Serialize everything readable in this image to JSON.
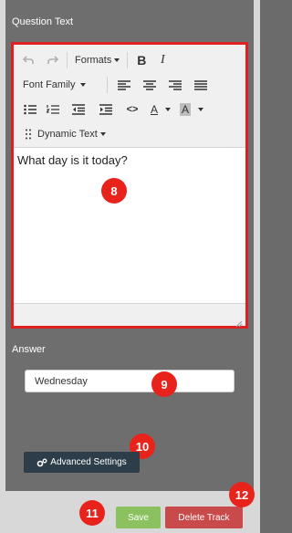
{
  "question_section": {
    "label": "Question Text"
  },
  "editor": {
    "toolbar": {
      "formats_label": "Formats",
      "font_family_label": "Font Family",
      "bold_label": "B",
      "italic_label": "I",
      "code_label": "<>",
      "font_color_label": "A",
      "bg_color_label": "A",
      "dynamic_text_label": "Dynamic Text"
    },
    "content": "What day is it today?"
  },
  "answer_section": {
    "label": "Answer",
    "value": "Wednesday"
  },
  "buttons": {
    "advanced_settings": "Advanced Settings",
    "save": "Save",
    "delete_track": "Delete Track"
  },
  "markers": {
    "editor": "8",
    "answer": "9",
    "advanced": "10",
    "save": "11",
    "delete": "12"
  },
  "colors": {
    "highlight_border": "#e02020",
    "marker": "#e8231c",
    "advanced_button": "#2d3e4a",
    "save_button": "#8cc15f",
    "delete_button": "#c94a4a"
  }
}
